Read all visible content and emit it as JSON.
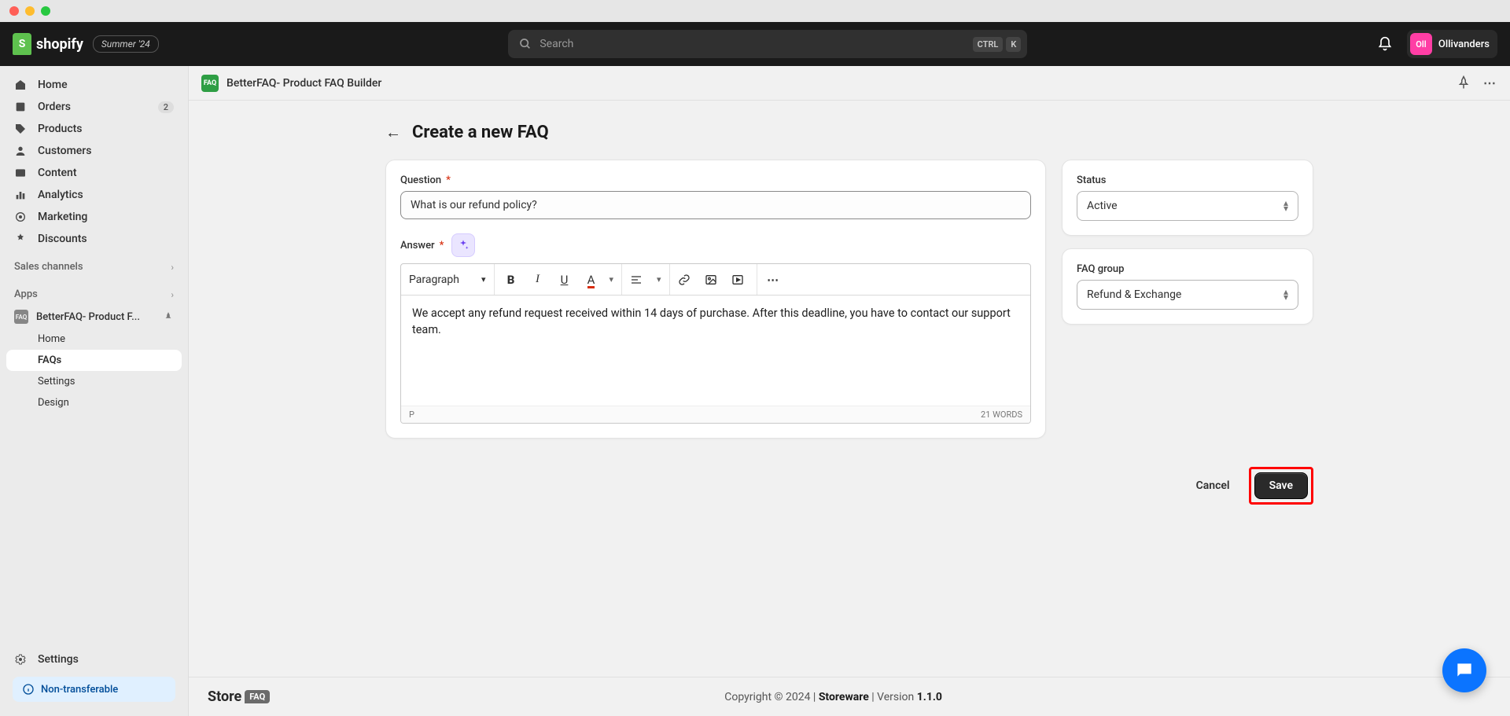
{
  "window": {
    "title": "shopify",
    "badge": "Summer '24"
  },
  "search": {
    "placeholder": "Search",
    "kbd1": "CTRL",
    "kbd2": "K"
  },
  "user": {
    "initials": "Oll",
    "name": "Ollivanders"
  },
  "nav": {
    "home": "Home",
    "orders": "Orders",
    "orders_badge": "2",
    "products": "Products",
    "customers": "Customers",
    "content": "Content",
    "analytics": "Analytics",
    "marketing": "Marketing",
    "discounts": "Discounts",
    "sales_channels": "Sales channels",
    "apps": "Apps",
    "app_name": "BetterFAQ- Product F...",
    "sub_home": "Home",
    "sub_faqs": "FAQs",
    "sub_settings": "Settings",
    "sub_design": "Design",
    "settings": "Settings",
    "non_transferable": "Non-transferable"
  },
  "contentHeader": {
    "appTitle": "BetterFAQ- Product FAQ Builder"
  },
  "page": {
    "title": "Create a new FAQ",
    "questionLabel": "Question",
    "questionValue": "What is our refund policy?",
    "answerLabel": "Answer",
    "paragraph": "Paragraph",
    "answerBody": "We accept any refund request received within 14 days of purchase. After this deadline, you have to contact our support team.",
    "pathP": "P",
    "wordCount": "21 WORDS",
    "statusLabel": "Status",
    "statusValue": "Active",
    "groupLabel": "FAQ group",
    "groupValue": "Refund & Exchange",
    "cancel": "Cancel",
    "save": "Save"
  },
  "footer": {
    "storeLogoText": "Store",
    "storeLogoBadge": "FAQ",
    "copyright": "Copyright © 2024 | ",
    "brand": "Storeware",
    "versionLabel": " | Version ",
    "version": "1.1.0"
  }
}
